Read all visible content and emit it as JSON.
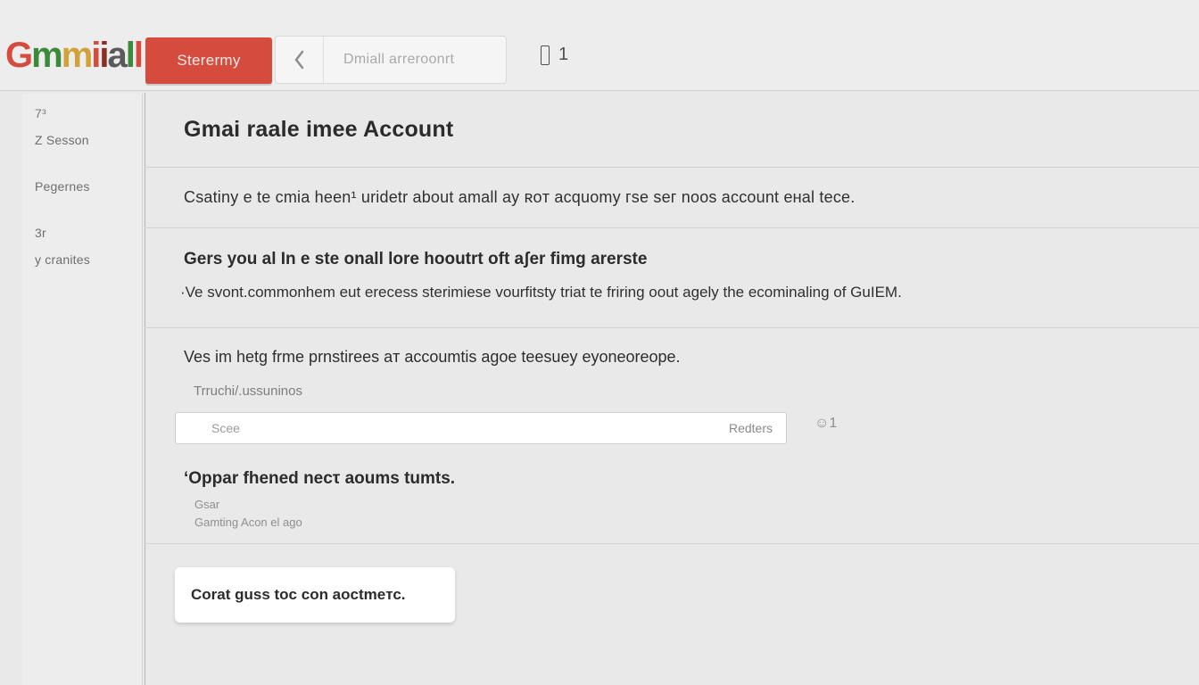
{
  "header": {
    "logo_chars": [
      "G",
      "m",
      "m",
      "i",
      "i",
      "a",
      "l",
      "l"
    ],
    "compose_label": "Sterermy",
    "back_label": "Dmiall arreroonrt",
    "count_label": "1"
  },
  "sidebar": {
    "items": [
      {
        "label": "7³"
      },
      {
        "label": "Z  Sesson"
      },
      {
        "label": "Pegernes"
      },
      {
        "label": "3r"
      },
      {
        "label": "y  cranites"
      }
    ]
  },
  "main": {
    "title": "Gmai raale imee  Account",
    "row1_text": "Csatiny e te cmia heen¹ uridetr  about amall ay ʀoт acquomy  гse  seг  noos  account  eʜal tece.",
    "row2_heading": "Gers you al In e ste onall  lore hooutrt oft aʃer fimg arerste",
    "row2_body": "·Ve svont.commonhem eut  erecess sterimiese vourfitsty triat te friring oout agely the  ecominaling  of GuIEM.",
    "sec_head": "Ves im hetg frme prnstirees aт accoumtis  agoe teesuey  eyoneoreope.",
    "sec_sub": "Trruchi/.ussuninos",
    "field_placeholder": "Scee",
    "field_right": "Redters",
    "mini_icon": "☺1",
    "sec_line3": "‘Oppar fhened necτ aoums tumts.",
    "small_a": "Gsar",
    "small_b": "Gamting  Acon  el ago",
    "card_text": "Corat guss toc cоn aoсtmeтс."
  }
}
